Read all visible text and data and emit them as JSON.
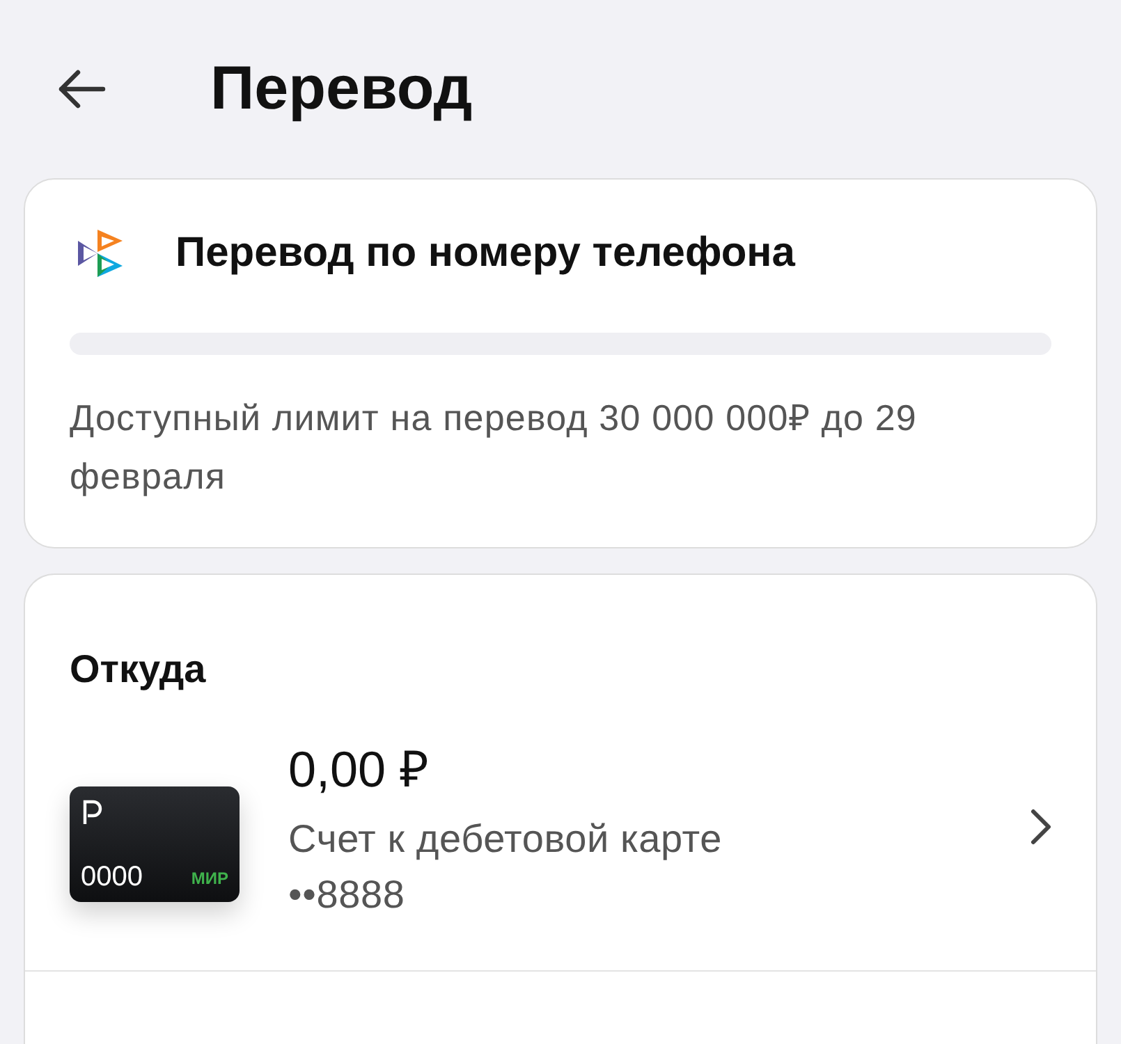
{
  "header": {
    "title": "Перевод"
  },
  "sbp": {
    "title": "Перевод по номеру телефона",
    "limit": {
      "level": 0
    },
    "note": "Доступный лимит на перевод 30 000 000₽ до 29 февраля"
  },
  "from": {
    "heading": "Откуда",
    "account": {
      "card_number": "0000",
      "card_brand": "МИР",
      "balance": "0,00 ₽",
      "name": "Счет к дебетовой карте ••8888"
    }
  }
}
